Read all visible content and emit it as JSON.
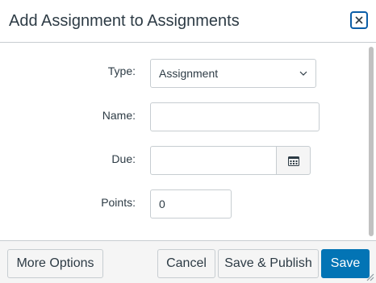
{
  "dialog": {
    "title": "Add Assignment to Assignments",
    "close_icon": "close-icon"
  },
  "form": {
    "type_label": "Type:",
    "type_value": "Assignment",
    "name_label": "Name:",
    "name_value": "",
    "due_label": "Due:",
    "due_value": "",
    "calendar_icon": "calendar-icon",
    "points_label": "Points:",
    "points_value": "0"
  },
  "footer": {
    "more_options": "More Options",
    "cancel": "Cancel",
    "save_publish": "Save & Publish",
    "save": "Save"
  },
  "colors": {
    "primary": "#0374b5",
    "text": "#2d3b45",
    "border": "#c7cdd1"
  }
}
